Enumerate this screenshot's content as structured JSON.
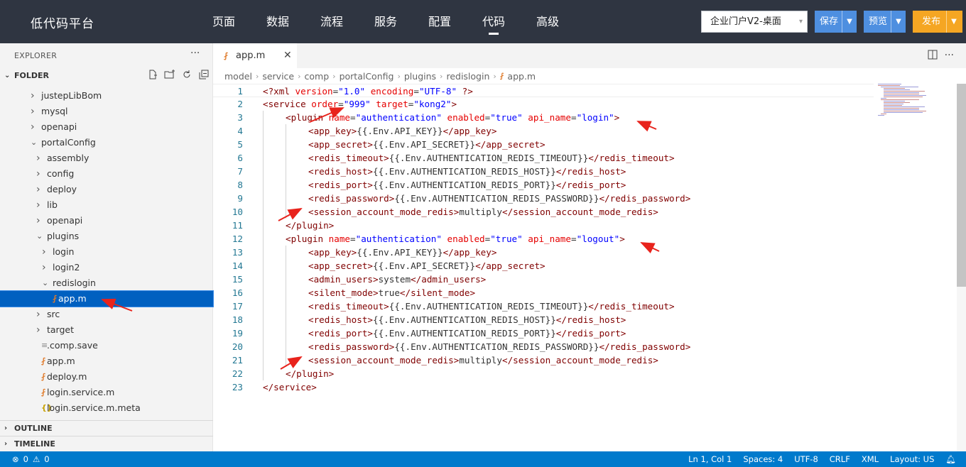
{
  "brand": "低代码平台",
  "nav": [
    "页面",
    "数据",
    "流程",
    "服务",
    "配置",
    "代码",
    "高级"
  ],
  "nav_active": "代码",
  "app_select": "企业门户V2-桌面",
  "buttons": {
    "save": "保存",
    "preview": "预览",
    "publish": "发布"
  },
  "sidebar": {
    "explorer_title": "EXPLORER",
    "folder_title": "FOLDER",
    "tree": [
      {
        "name": "justepLibBom",
        "indent": 0,
        "kind": "folder",
        "open": false
      },
      {
        "name": "mysql",
        "indent": 0,
        "kind": "folder",
        "open": false
      },
      {
        "name": "openapi",
        "indent": 0,
        "kind": "folder",
        "open": false
      },
      {
        "name": "portalConfig",
        "indent": 0,
        "kind": "folder",
        "open": true
      },
      {
        "name": "assembly",
        "indent": 1,
        "kind": "folder",
        "open": false
      },
      {
        "name": "config",
        "indent": 1,
        "kind": "folder",
        "open": false
      },
      {
        "name": "deploy",
        "indent": 1,
        "kind": "folder",
        "open": false
      },
      {
        "name": "lib",
        "indent": 1,
        "kind": "folder",
        "open": false
      },
      {
        "name": "openapi",
        "indent": 1,
        "kind": "folder",
        "open": false
      },
      {
        "name": "plugins",
        "indent": 1,
        "kind": "folder",
        "open": true
      },
      {
        "name": "login",
        "indent": 2,
        "kind": "folder",
        "open": false
      },
      {
        "name": "login2",
        "indent": 2,
        "kind": "folder",
        "open": false
      },
      {
        "name": "redislogin",
        "indent": 2,
        "kind": "folder",
        "open": true
      },
      {
        "name": "app.m",
        "indent": 3,
        "kind": "rss",
        "selected": true
      },
      {
        "name": "src",
        "indent": 1,
        "kind": "folder",
        "open": false
      },
      {
        "name": "target",
        "indent": 1,
        "kind": "folder",
        "open": false
      },
      {
        "name": ".comp.save",
        "indent": 1,
        "kind": "lines"
      },
      {
        "name": "app.m",
        "indent": 1,
        "kind": "rss"
      },
      {
        "name": "deploy.m",
        "indent": 1,
        "kind": "rss"
      },
      {
        "name": "login.service.m",
        "indent": 1,
        "kind": "rss"
      },
      {
        "name": "login.service.m.meta",
        "indent": 1,
        "kind": "brace"
      }
    ],
    "outline": "OUTLINE",
    "timeline": "TIMELINE"
  },
  "editor": {
    "tab": "app.m",
    "breadcrumb": [
      "model",
      "service",
      "comp",
      "portalConfig",
      "plugins",
      "redislogin",
      "app.m"
    ],
    "lines": [
      {
        "i": 0,
        "p": [
          [
            "t",
            "<?xml "
          ],
          [
            "a",
            "version"
          ],
          [
            "o",
            "="
          ],
          [
            "v",
            "\"1.0\""
          ],
          [
            "o",
            " "
          ],
          [
            "a",
            "encoding"
          ],
          [
            "o",
            "="
          ],
          [
            "v",
            "\"UTF-8\""
          ],
          [
            "o",
            " "
          ],
          [
            "t",
            "?>"
          ]
        ]
      },
      {
        "i": 0,
        "p": [
          [
            "t",
            "<service "
          ],
          [
            "a",
            "order"
          ],
          [
            "o",
            "="
          ],
          [
            "v",
            "\"999\""
          ],
          [
            "o",
            " "
          ],
          [
            "a",
            "target"
          ],
          [
            "o",
            "="
          ],
          [
            "v",
            "\"kong2\""
          ],
          [
            "t",
            ">"
          ]
        ]
      },
      {
        "i": 1,
        "p": [
          [
            "t",
            "<plugin "
          ],
          [
            "a",
            "name"
          ],
          [
            "o",
            "="
          ],
          [
            "v",
            "\"authentication\""
          ],
          [
            "o",
            " "
          ],
          [
            "a",
            "enabled"
          ],
          [
            "o",
            "="
          ],
          [
            "v",
            "\"true\""
          ],
          [
            "o",
            " "
          ],
          [
            "a",
            "api_name"
          ],
          [
            "o",
            "="
          ],
          [
            "v",
            "\"login\""
          ],
          [
            "t",
            ">"
          ]
        ]
      },
      {
        "i": 2,
        "p": [
          [
            "t",
            "<app_key>"
          ],
          [
            "o",
            "{{.Env.API_KEY}}"
          ],
          [
            "t",
            "</app_key>"
          ]
        ]
      },
      {
        "i": 2,
        "p": [
          [
            "t",
            "<app_secret>"
          ],
          [
            "o",
            "{{.Env.API_SECRET}}"
          ],
          [
            "t",
            "</app_secret>"
          ]
        ]
      },
      {
        "i": 2,
        "p": [
          [
            "t",
            "<redis_timeout>"
          ],
          [
            "o",
            "{{.Env.AUTHENTICATION_REDIS_TIMEOUT}}"
          ],
          [
            "t",
            "</redis_timeout>"
          ]
        ]
      },
      {
        "i": 2,
        "p": [
          [
            "t",
            "<redis_host>"
          ],
          [
            "o",
            "{{.Env.AUTHENTICATION_REDIS_HOST}}"
          ],
          [
            "t",
            "</redis_host>"
          ]
        ]
      },
      {
        "i": 2,
        "p": [
          [
            "t",
            "<redis_port>"
          ],
          [
            "o",
            "{{.Env.AUTHENTICATION_REDIS_PORT}}"
          ],
          [
            "t",
            "</redis_port>"
          ]
        ]
      },
      {
        "i": 2,
        "p": [
          [
            "t",
            "<redis_password>"
          ],
          [
            "o",
            "{{.Env.AUTHENTICATION_REDIS_PASSWORD}}"
          ],
          [
            "t",
            "</redis_password>"
          ]
        ]
      },
      {
        "i": 2,
        "p": [
          [
            "t",
            "<session_account_mode_redis>"
          ],
          [
            "o",
            "multiply"
          ],
          [
            "t",
            "</session_account_mode_redis>"
          ]
        ]
      },
      {
        "i": 1,
        "p": [
          [
            "t",
            "</plugin>"
          ]
        ]
      },
      {
        "i": 1,
        "p": [
          [
            "t",
            "<plugin "
          ],
          [
            "a",
            "name"
          ],
          [
            "o",
            "="
          ],
          [
            "v",
            "\"authentication\""
          ],
          [
            "o",
            " "
          ],
          [
            "a",
            "enabled"
          ],
          [
            "o",
            "="
          ],
          [
            "v",
            "\"true\""
          ],
          [
            "o",
            " "
          ],
          [
            "a",
            "api_name"
          ],
          [
            "o",
            "="
          ],
          [
            "v",
            "\"logout\""
          ],
          [
            "t",
            ">"
          ]
        ]
      },
      {
        "i": 2,
        "p": [
          [
            "t",
            "<app_key>"
          ],
          [
            "o",
            "{{.Env.API_KEY}}"
          ],
          [
            "t",
            "</app_key>"
          ]
        ]
      },
      {
        "i": 2,
        "p": [
          [
            "t",
            "<app_secret>"
          ],
          [
            "o",
            "{{.Env.API_SECRET}}"
          ],
          [
            "t",
            "</app_secret>"
          ]
        ]
      },
      {
        "i": 2,
        "p": [
          [
            "t",
            "<admin_users>"
          ],
          [
            "o",
            "system"
          ],
          [
            "t",
            "</admin_users>"
          ]
        ]
      },
      {
        "i": 2,
        "p": [
          [
            "t",
            "<silent_mode>"
          ],
          [
            "o",
            "true"
          ],
          [
            "t",
            "</silent_mode>"
          ]
        ]
      },
      {
        "i": 2,
        "p": [
          [
            "t",
            "<redis_timeout>"
          ],
          [
            "o",
            "{{.Env.AUTHENTICATION_REDIS_TIMEOUT}}"
          ],
          [
            "t",
            "</redis_timeout>"
          ]
        ]
      },
      {
        "i": 2,
        "p": [
          [
            "t",
            "<redis_host>"
          ],
          [
            "o",
            "{{.Env.AUTHENTICATION_REDIS_HOST}}"
          ],
          [
            "t",
            "</redis_host>"
          ]
        ]
      },
      {
        "i": 2,
        "p": [
          [
            "t",
            "<redis_port>"
          ],
          [
            "o",
            "{{.Env.AUTHENTICATION_REDIS_PORT}}"
          ],
          [
            "t",
            "</redis_port>"
          ]
        ]
      },
      {
        "i": 2,
        "p": [
          [
            "t",
            "<redis_password>"
          ],
          [
            "o",
            "{{.Env.AUTHENTICATION_REDIS_PASSWORD}}"
          ],
          [
            "t",
            "</redis_password>"
          ]
        ]
      },
      {
        "i": 2,
        "p": [
          [
            "t",
            "<session_account_mode_redis>"
          ],
          [
            "o",
            "multiply"
          ],
          [
            "t",
            "</session_account_mode_redis>"
          ]
        ]
      },
      {
        "i": 1,
        "p": [
          [
            "t",
            "</plugin>"
          ]
        ]
      },
      {
        "i": 0,
        "p": [
          [
            "t",
            "</service>"
          ]
        ]
      }
    ]
  },
  "status": {
    "errors": "0",
    "warnings": "0",
    "position": "Ln 1, Col 1",
    "spaces": "Spaces: 4",
    "encoding": "UTF-8",
    "eol": "CRLF",
    "language": "XML",
    "layout": "Layout: US"
  },
  "colors": {
    "topbar": "#2f3541",
    "accent": "#007acc",
    "selection": "#0060c0",
    "publish": "#f5a623",
    "primary": "#4e8fe0",
    "annotation_arrow": "#e8231c"
  },
  "icons": {
    "file_rss": "rss-file-icon",
    "file_lines": "lines-file-icon",
    "file_json": "braces-file-icon"
  }
}
